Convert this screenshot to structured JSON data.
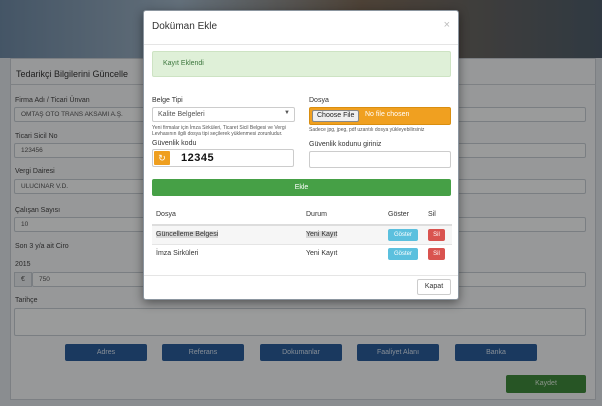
{
  "background": {
    "panel_title": "Tedarikçi Bilgilerini Güncelle",
    "fields": [
      {
        "label": "Firma Adı / Ticari Ünvan",
        "value": "OMTAŞ OTO TRANS AKSAMI A.Ş."
      },
      {
        "label": "Ticari Sicil No",
        "value": "123456"
      },
      {
        "label": "Vergi Dairesi",
        "value": "ULUCINAR V.D."
      },
      {
        "label": "Çalışan Sayısı",
        "value": "10"
      },
      {
        "label": "Son 3 y/a ait Ciro",
        "value": ""
      }
    ],
    "year_label": "2015",
    "currency_symbol": "€",
    "revenue_value": "750",
    "history_label": "Tarihçe",
    "nav_buttons": [
      "Adres",
      "Referans",
      "Dokumanlar",
      "Faaliyet Alanı",
      "Banka"
    ],
    "save_label": "Kaydet"
  },
  "modal": {
    "title": "Doküman Ekle",
    "close_glyph": "×",
    "alert": "Kayıt Eklendi",
    "doc_type_label": "Belge Tipi",
    "doc_type_value": "Kalite Belgeleri",
    "doc_type_help": "Yeni firmalar için İmza Sirküleri, Ticaret Sicil Belgesi ve Vergi Levhasının ilgili dosya tipi seçilerek yüklenmesi zorunludur.",
    "file_label": "Dosya",
    "file_button": "Choose File",
    "file_status": "No file chosen",
    "file_help": "Sadece jpg, jpeg, pdf uzantılı dosya yükleyebilirsiniz",
    "captcha_label": "Güvenlik kodu",
    "captcha_code": "12345",
    "captcha_input_label": "Güvenlik kodunu giriniz",
    "captcha_input_value": "",
    "submit_label": "Ekle",
    "table": {
      "headers": [
        "Dosya",
        "Durum",
        "Göster",
        "Sil"
      ],
      "rows": [
        {
          "file": "Güncelleme Belgesi",
          "status": "Yeni Kayıt",
          "show": "Göster",
          "delete": "Sil"
        },
        {
          "file": "İmza Sirküleri",
          "status": "Yeni Kayıt",
          "show": "Göster",
          "delete": "Sil"
        }
      ]
    },
    "close_label": "Kapat"
  },
  "colors": {
    "success": "#46a046",
    "info": "#5bc0de",
    "danger": "#d9534f",
    "warning": "#f0a020",
    "nav": "#2b5d9a"
  }
}
